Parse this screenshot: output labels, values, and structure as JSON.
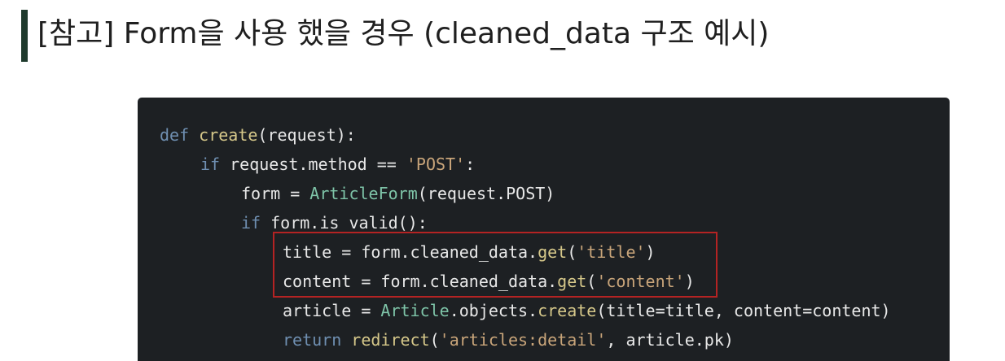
{
  "header": {
    "title": "[참고] Form을 사용 했을 경우 (cleaned_data 구조 예시)"
  },
  "code": {
    "line1": {
      "kw": "def ",
      "fn": "create",
      "rest": "(request):"
    },
    "line2": {
      "kw": "if ",
      "a": "request.method == ",
      "str": "'POST'",
      "b": ":"
    },
    "line3": {
      "a": "form = ",
      "cls": "ArticleForm",
      "b": "(request.POST)"
    },
    "line4": {
      "kw": "if ",
      "a": "form.is_valid():"
    },
    "line5": {
      "a": "title = form.cleaned_data.",
      "fn": "get",
      "b": "(",
      "str": "'title'",
      "c": ")"
    },
    "line6": {
      "a": "content = form.cleaned_data.",
      "fn": "get",
      "b": "(",
      "str": "'content'",
      "c": ")"
    },
    "line7": {
      "a": "article = ",
      "cls": "Article",
      "b": ".objects.",
      "fn": "create",
      "c": "(title=title, content=content)"
    },
    "line8": {
      "kw": "return ",
      "fn": "redirect",
      "b": "(",
      "str": "'articles:detail'",
      "c": ", article.pk)"
    }
  },
  "colors": {
    "accent_bar": "#1e3a2c",
    "code_background": "#1d2023",
    "highlight_border": "#b42323"
  }
}
